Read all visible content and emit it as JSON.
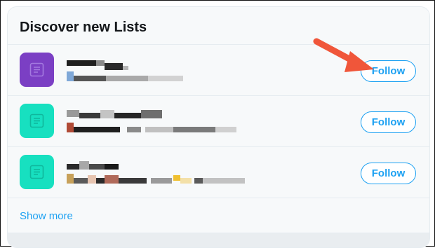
{
  "panel": {
    "title": "Discover new Lists",
    "show_more_label": "Show more"
  },
  "lists": [
    {
      "thumb_color": "#7b3fc4",
      "follow_label": "Follow",
      "icon": "list-icon"
    },
    {
      "thumb_color": "#17e0c0",
      "follow_label": "Follow",
      "icon": "list-icon"
    },
    {
      "thumb_color": "#17e0c0",
      "follow_label": "Follow",
      "icon": "list-icon"
    }
  ],
  "annotation": {
    "icon": "red-arrow-icon",
    "color": "#f0563a"
  },
  "colors": {
    "accent": "#1da1f2",
    "background": "#f7f9fa",
    "border": "#e6ecf0"
  }
}
